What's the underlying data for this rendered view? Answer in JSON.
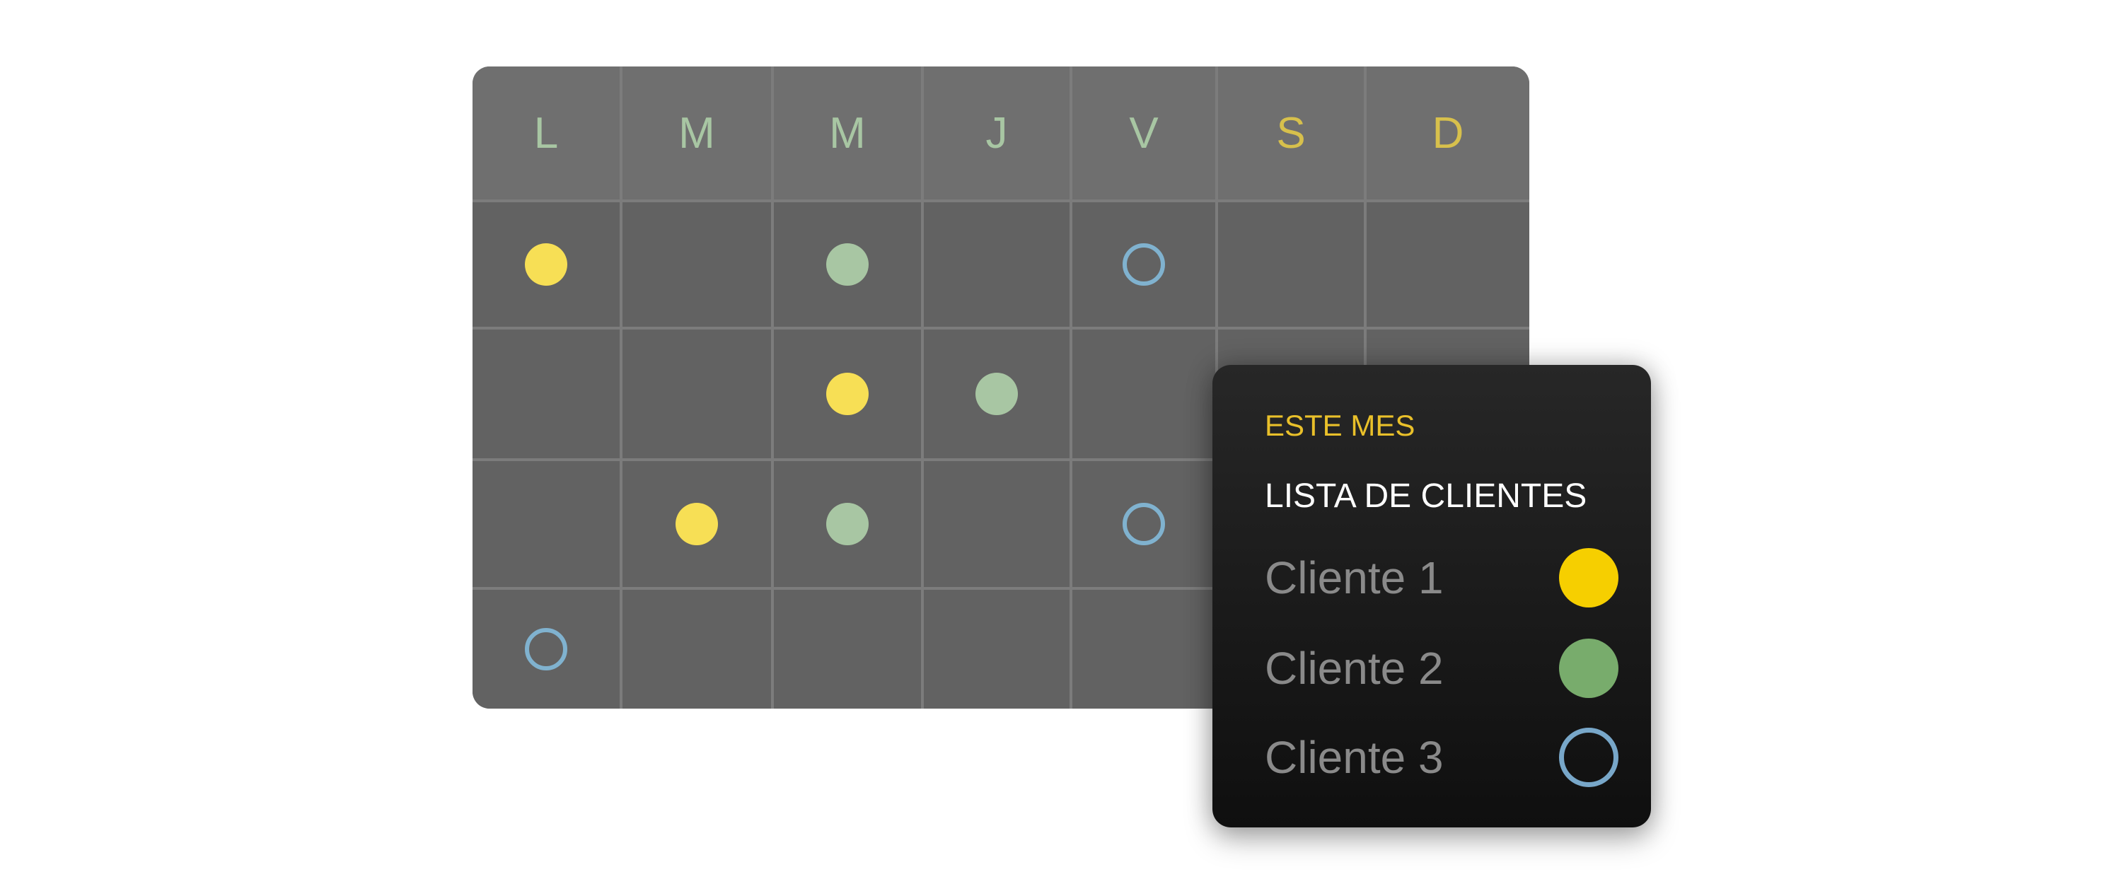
{
  "calendar": {
    "days": [
      {
        "label": "L",
        "type": "weekday"
      },
      {
        "label": "M",
        "type": "weekday"
      },
      {
        "label": "M",
        "type": "weekday"
      },
      {
        "label": "J",
        "type": "weekday"
      },
      {
        "label": "V",
        "type": "weekday"
      },
      {
        "label": "S",
        "type": "weekend"
      },
      {
        "label": "D",
        "type": "weekend"
      }
    ],
    "weeks": [
      [
        "client-1",
        "",
        "client-2",
        "",
        "client-3",
        "",
        ""
      ],
      [
        "",
        "",
        "client-1",
        "client-2",
        "",
        "",
        ""
      ],
      [
        "",
        "client-1",
        "client-2",
        "",
        "client-3",
        "",
        ""
      ],
      [
        "client-3",
        "",
        "",
        "",
        "",
        "",
        ""
      ]
    ]
  },
  "popup": {
    "label": "ESTE MES",
    "title": "LISTA DE CLIENTES",
    "clients": [
      {
        "id": "client-1",
        "name": "Cliente 1",
        "color": "#f6cf00",
        "style": "filled"
      },
      {
        "id": "client-2",
        "name": "Cliente 2",
        "color": "#78ac6c",
        "style": "filled"
      },
      {
        "id": "client-3",
        "name": "Cliente 3",
        "color": "#78a7c9",
        "style": "outline"
      }
    ]
  },
  "colors": {
    "calendar_client_1": "#f7df55",
    "calendar_client_2": "#a8c6a3",
    "calendar_client_3": "#80b2cf",
    "weekday_label": "#a8c6a3",
    "weekend_label": "#d7c04c",
    "popup_label": "#e9c02a"
  }
}
